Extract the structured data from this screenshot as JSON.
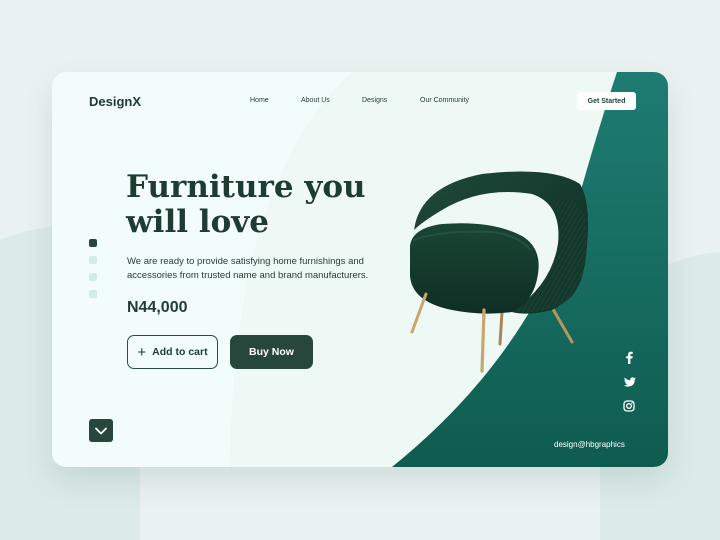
{
  "brand": {
    "logo": "DesignX"
  },
  "nav": {
    "items": [
      "Home",
      "About Us",
      "Designs",
      "Our Community"
    ],
    "cta": "Get Started"
  },
  "hero": {
    "headline": [
      "Furniture you",
      "will love"
    ],
    "description": "We are ready to provide satisfying home furnishings and accessories from trusted name and brand manufacturers.",
    "price": "N44,000",
    "add_to_cart": "Add to cart",
    "buy_now": "Buy Now"
  },
  "slider": {
    "count": 4,
    "active_index": 1
  },
  "footer": {
    "email": "design@hbgraphics"
  },
  "icons": {
    "plus": "plus-icon",
    "chevron": "chevron-down-icon",
    "social": [
      "facebook-icon",
      "twitter-icon",
      "instagram-icon"
    ]
  },
  "colors": {
    "page_bg": "#e9f1f0",
    "card_bg": "#eef9f6",
    "accent_dark": "#27473d",
    "teal": "#1a6b62",
    "text": "#1f3c32",
    "dot_active": "#27473d",
    "dot_inactive": "#d3ece7"
  }
}
